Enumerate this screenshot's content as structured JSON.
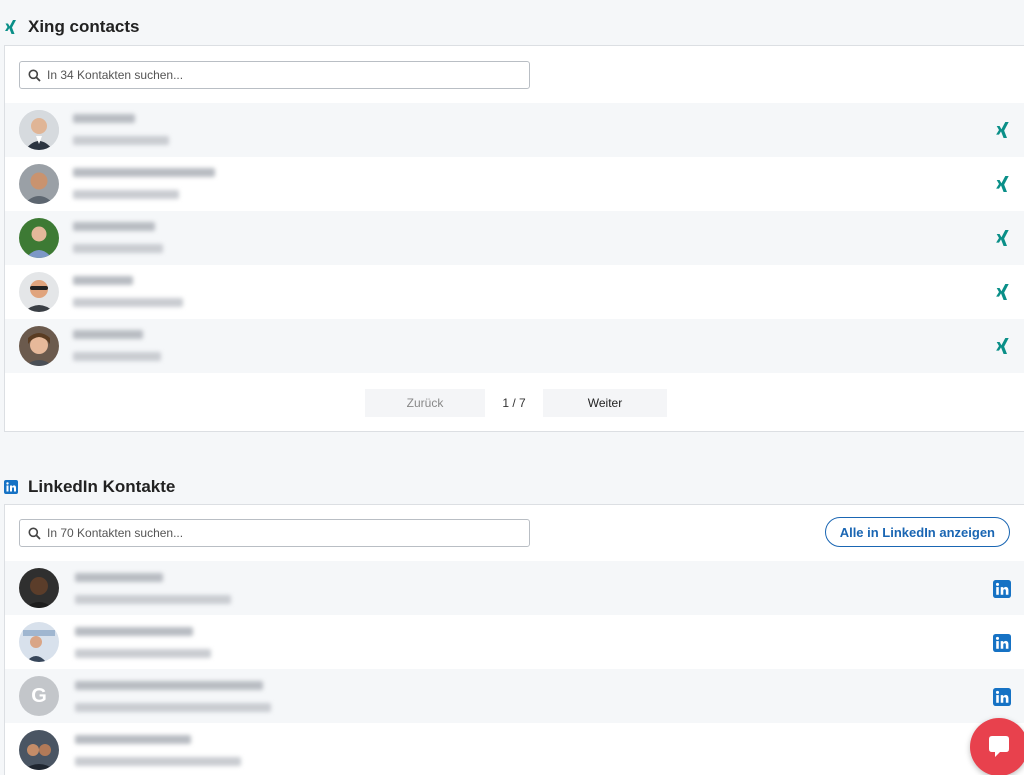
{
  "xing": {
    "title": "Xing contacts",
    "search_placeholder": "In 34 Kontakten suchen...",
    "contacts": [
      {
        "icon": "xing-icon"
      },
      {
        "icon": "xing-icon"
      },
      {
        "icon": "xing-icon"
      },
      {
        "icon": "xing-icon"
      },
      {
        "icon": "xing-icon"
      }
    ],
    "pagination": {
      "prev_label": "Zurück",
      "page": "1 / 7",
      "next_label": "Weiter"
    }
  },
  "linkedin": {
    "title": "LinkedIn Kontakte",
    "search_placeholder": "In 70 Kontakten suchen...",
    "show_all_label": "Alle in LinkedIn anzeigen",
    "contacts": [
      {
        "icon": "linkedin-icon"
      },
      {
        "icon": "linkedin-icon"
      },
      {
        "icon": "linkedin-icon",
        "avatar_initial": "G"
      },
      {
        "icon": "linkedin-icon"
      }
    ]
  },
  "colors": {
    "xing": "#0a8f88",
    "linkedin": "#1672c4",
    "chat": "#e8414d"
  }
}
